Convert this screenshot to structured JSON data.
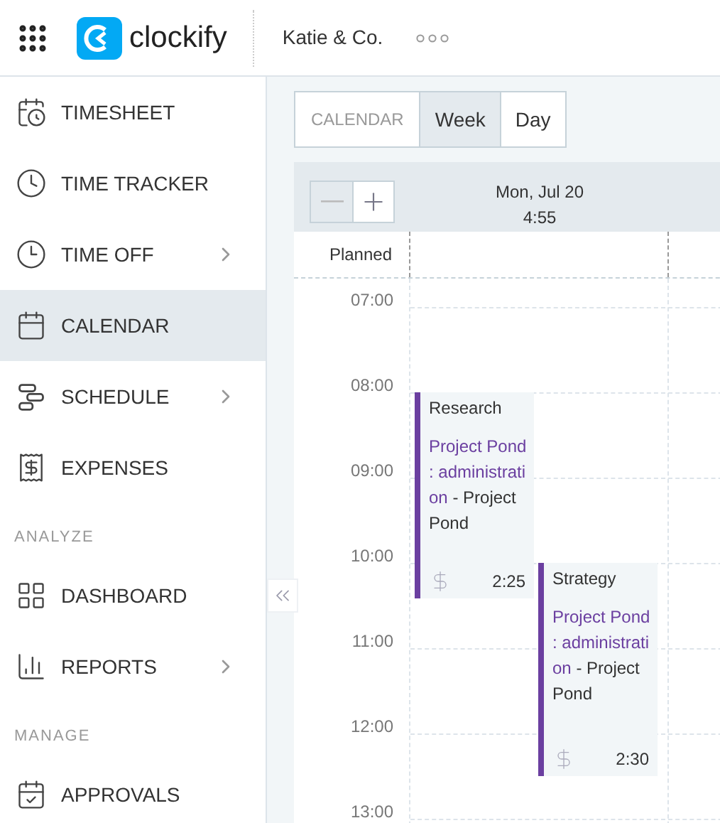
{
  "header": {
    "logo_text": "clockify",
    "workspace": "Katie & Co."
  },
  "sidebar": {
    "sections": [
      {
        "items": [
          {
            "label": "TIMESHEET",
            "expandable": false,
            "selected": false
          },
          {
            "label": "TIME TRACKER",
            "expandable": false,
            "selected": false
          },
          {
            "label": "TIME OFF",
            "expandable": true,
            "selected": false
          },
          {
            "label": "CALENDAR",
            "expandable": false,
            "selected": true
          },
          {
            "label": "SCHEDULE",
            "expandable": true,
            "selected": false
          },
          {
            "label": "EXPENSES",
            "expandable": false,
            "selected": false
          }
        ]
      },
      {
        "title": "ANALYZE",
        "items": [
          {
            "label": "DASHBOARD",
            "expandable": false,
            "selected": false
          },
          {
            "label": "REPORTS",
            "expandable": true,
            "selected": false
          }
        ]
      },
      {
        "title": "MANAGE",
        "items": [
          {
            "label": "APPROVALS",
            "expandable": false,
            "selected": false
          }
        ]
      }
    ]
  },
  "view_switch": {
    "label": "CALENDAR",
    "options": [
      {
        "label": "Week",
        "selected": true
      },
      {
        "label": "Day",
        "selected": false
      }
    ]
  },
  "calendar": {
    "day": "Mon, Jul 20",
    "day_total": "4:55",
    "planned_label": "Planned",
    "hours": [
      "07:00",
      "08:00",
      "09:00",
      "10:00",
      "11:00",
      "12:00",
      "13:00"
    ],
    "events": [
      {
        "title": "Research",
        "project_task": "Project Pond : administration",
        "client": " - Project Pond",
        "billable": true,
        "duration": "2:25"
      },
      {
        "title": "Strategy",
        "project_task": "Project Pond : administration",
        "client": " - Project Pond",
        "billable": true,
        "duration": "2:30"
      }
    ]
  }
}
